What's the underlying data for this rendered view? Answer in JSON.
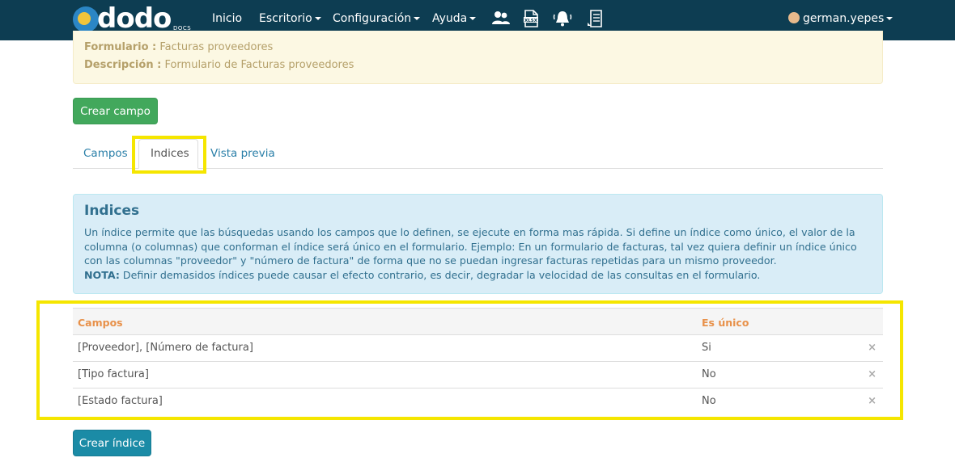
{
  "navbar": {
    "logo_text": "dodo",
    "logo_sub": "DOCS",
    "items": [
      {
        "label": "Inicio"
      },
      {
        "label": "Escritorio"
      },
      {
        "label": "Configuración"
      },
      {
        "label": "Ayuda"
      }
    ],
    "icons": [
      "users-icon",
      "xlsx-file-icon",
      "bell-icon",
      "document-list-icon"
    ],
    "user": "german.yepes"
  },
  "form_info": {
    "formulario_label": "Formulario :",
    "formulario_value": "Facturas proveedores",
    "descripcion_label": "Descripción :",
    "descripcion_value": "Formulario de Facturas proveedores"
  },
  "buttons": {
    "crear_campo": "Crear campo",
    "crear_indice": "Crear índice"
  },
  "tabs": [
    {
      "label": "Campos",
      "active": false
    },
    {
      "label": "Indices",
      "active": true
    },
    {
      "label": "Vista previa",
      "active": false
    }
  ],
  "info": {
    "title": "Indices",
    "body": "Un índice permite que las búsquedas usando los campos que lo definen, se ejecute en forma mas rápida. Si define un índice como único, el valor de la columna (o columnas) que conforman el índice será único en el formulario. Ejemplo: En un formulario de facturas, tal vez quiera definir un índice único con las columnas \"proveedor\" y \"número de factura\" de forma que no se puedan ingresar facturas repetidas para un mismo proveedor.",
    "note_label": "NOTA:",
    "note_text": " Definir demasidos índices puede causar el efecto contrario, es decir, degradar la velocidad de las consultas en el formulario."
  },
  "table": {
    "headers": {
      "campos": "Campos",
      "unico": "Es único"
    },
    "rows": [
      {
        "campos": "[Proveedor], [Número de factura]",
        "unico": "Si",
        "delete": "×"
      },
      {
        "campos": "[Tipo factura]",
        "unico": "No",
        "delete": "×"
      },
      {
        "campos": "[Estado factura]",
        "unico": "No",
        "delete": "×"
      }
    ]
  },
  "colors": {
    "navbar": "#0d3d52",
    "highlight": "#f5e600",
    "header_text": "#e8914a",
    "btn_green": "#42a85c",
    "btn_blue": "#1b8ba6"
  }
}
